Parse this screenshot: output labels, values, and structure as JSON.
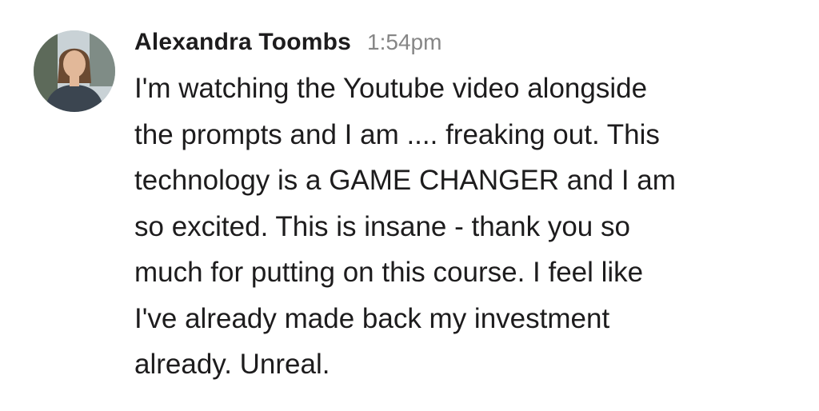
{
  "message": {
    "author": "Alexandra Toombs",
    "timestamp": "1:54pm",
    "avatar_icon": "user-avatar-photo",
    "lines": [
      "I'm watching the Youtube video alongside",
      "the prompts and I am .... freaking out. This",
      "technology is a GAME CHANGER and I am",
      "so excited. This is insane - thank you so",
      "much for putting on this course. I feel like",
      "I've already made back my investment",
      "already. Unreal."
    ]
  },
  "colors": {
    "author_text": "#1d1c1d",
    "timestamp_text": "#868686",
    "body_text": "#1d1c1d",
    "background": "#ffffff"
  }
}
